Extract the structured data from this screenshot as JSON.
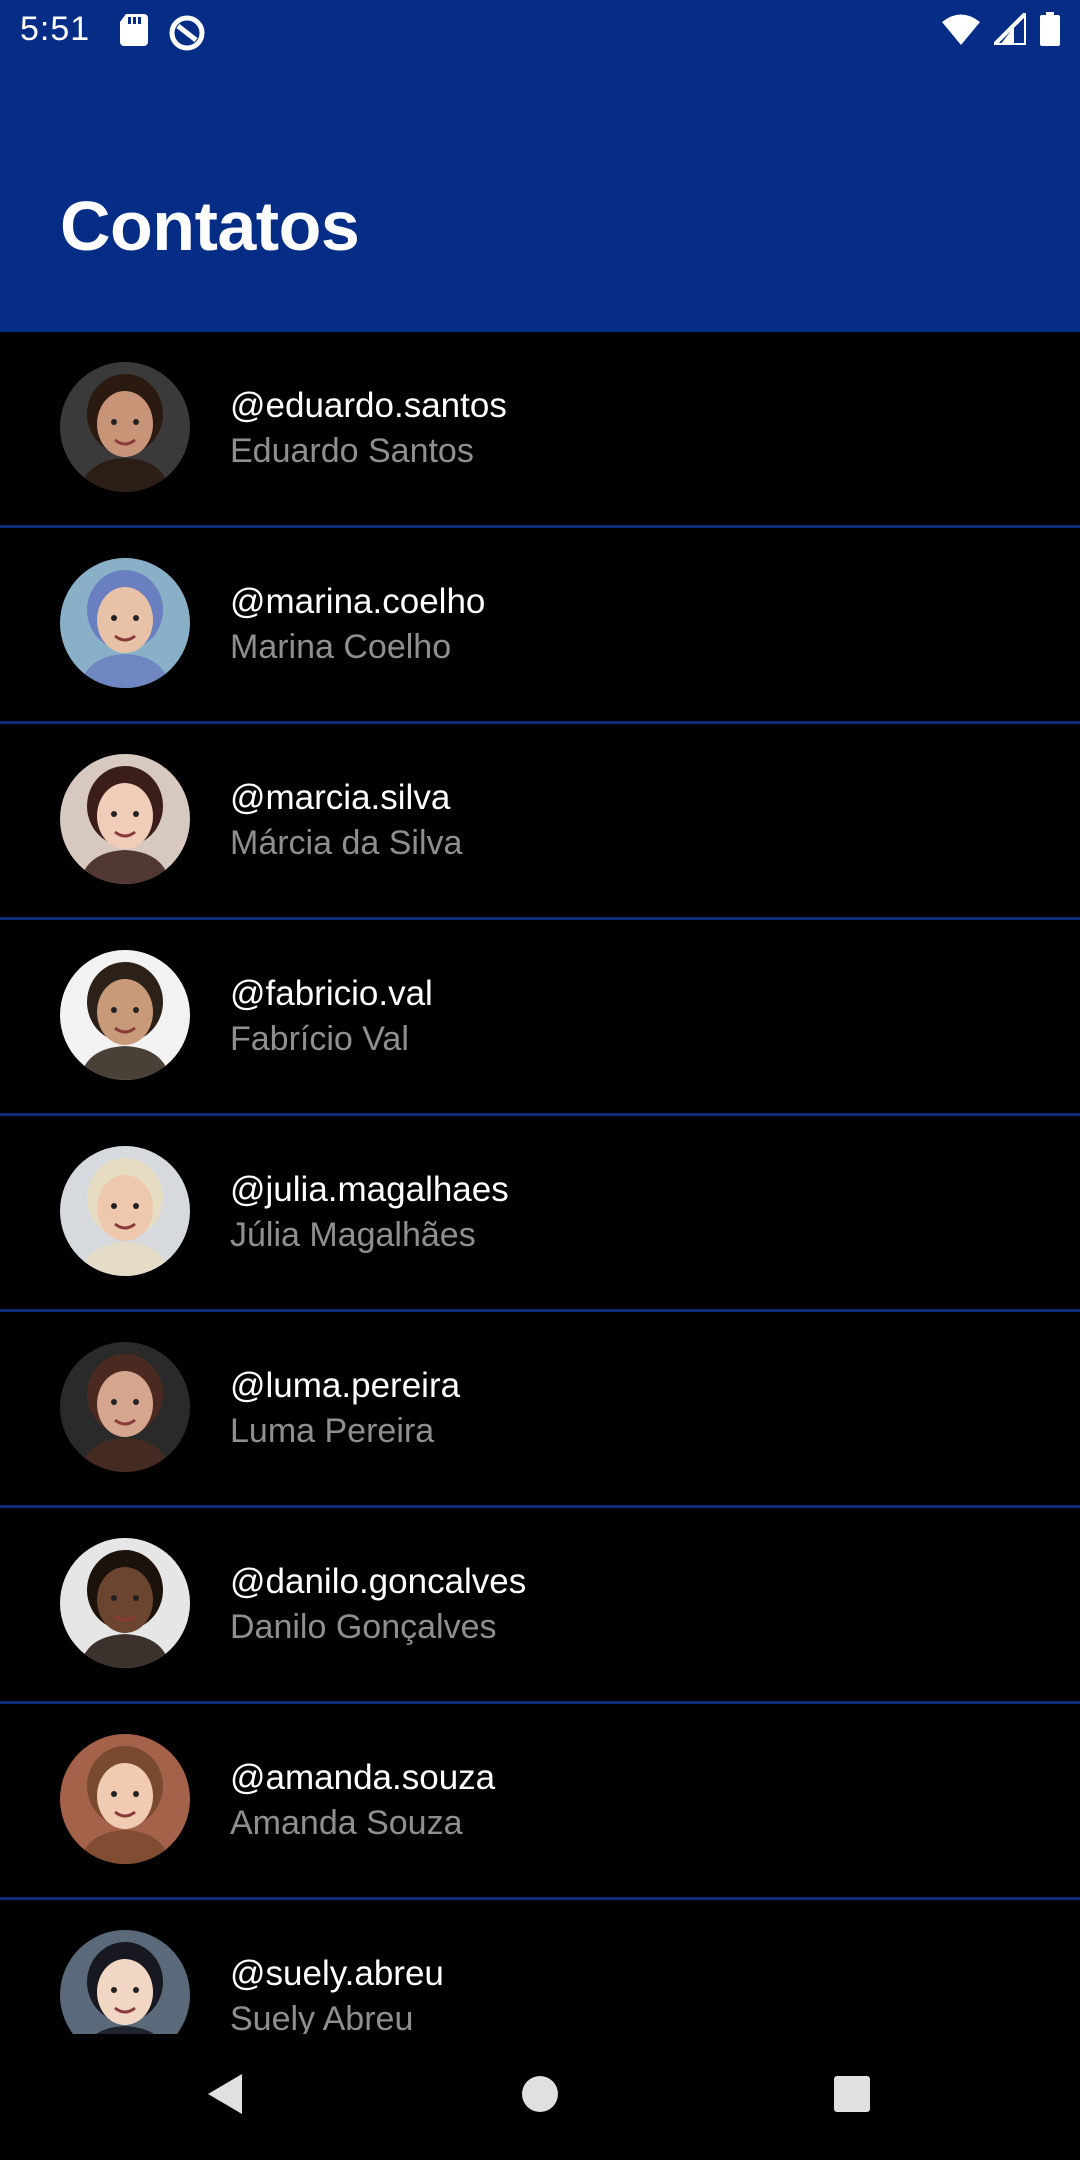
{
  "status_bar": {
    "time": "5:51",
    "left_icons": [
      "sd-card-icon",
      "data-saver-icon"
    ],
    "right_icons": [
      "wifi-icon",
      "signal-icon",
      "battery-icon"
    ]
  },
  "app_bar": {
    "title": "Contatos",
    "color": "#062d85"
  },
  "contacts": [
    {
      "handle": "@eduardo.santos",
      "name": "Eduardo Santos",
      "avatar_bg": "#3a3a3a",
      "skin": "#c89478",
      "hair": "#2a1a10"
    },
    {
      "handle": "@marina.coelho",
      "name": "Marina Coelho",
      "avatar_bg": "#8ab0c8",
      "skin": "#e8c2a6",
      "hair": "#6a7fc0"
    },
    {
      "handle": "@marcia.silva",
      "name": "Márcia da Silva",
      "avatar_bg": "#d7c8c0",
      "skin": "#f0cdb8",
      "hair": "#3b1e1a"
    },
    {
      "handle": "@fabricio.val",
      "name": "Fabrício Val",
      "avatar_bg": "#f2f2f2",
      "skin": "#c99a7a",
      "hair": "#2b2118"
    },
    {
      "handle": "@julia.magalhaes",
      "name": "Júlia Magalhães",
      "avatar_bg": "#d6dadf",
      "skin": "#edc8ad",
      "hair": "#e6dcc2"
    },
    {
      "handle": "@luma.pereira",
      "name": "Luma Pereira",
      "avatar_bg": "#2a2a2a",
      "skin": "#d6a58e",
      "hair": "#4a2a20"
    },
    {
      "handle": "@danilo.goncalves",
      "name": "Danilo Gonçalves",
      "avatar_bg": "#e6e6e6",
      "skin": "#6b4530",
      "hair": "#1c120c"
    },
    {
      "handle": "@amanda.souza",
      "name": "Amanda Souza",
      "avatar_bg": "#a4624a",
      "skin": "#f0cbb2",
      "hair": "#7a4a2e"
    },
    {
      "handle": "@suely.abreu",
      "name": "Suely Abreu",
      "avatar_bg": "#5a6a7a",
      "skin": "#f2d6c4",
      "hair": "#181820"
    }
  ],
  "nav_bar": {
    "buttons": [
      "back-icon",
      "home-icon",
      "recents-icon"
    ]
  }
}
